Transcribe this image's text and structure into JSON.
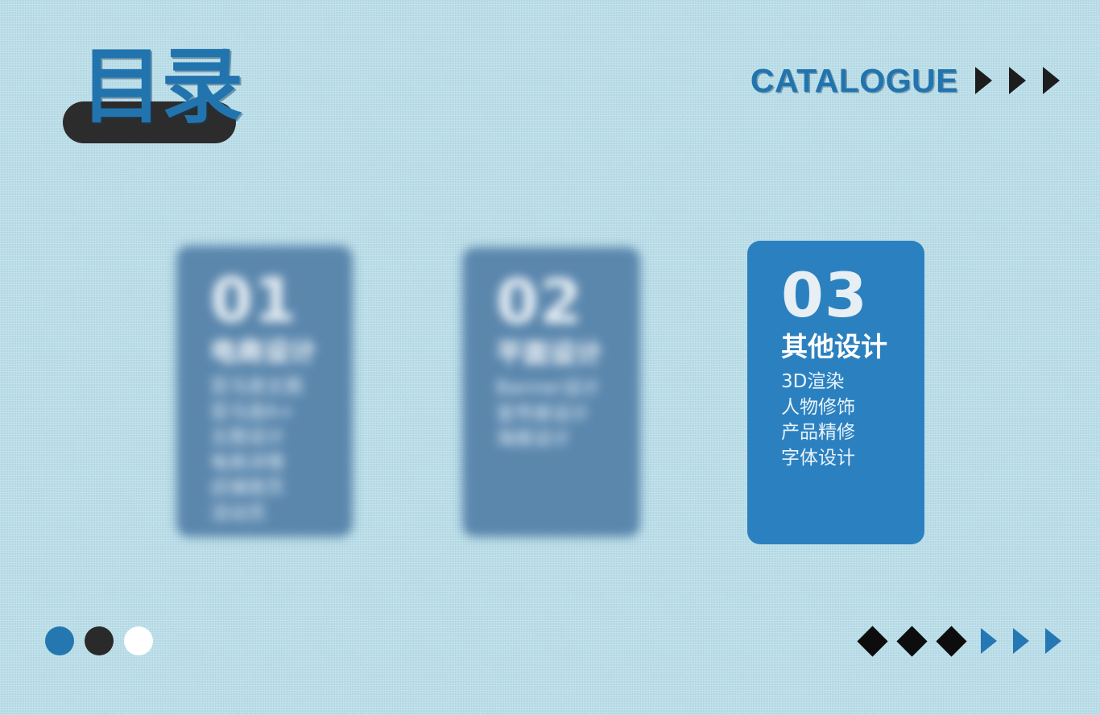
{
  "slide": {
    "background_color": "#b5dde9",
    "accent_blue": "#2274ae",
    "card_focus_color": "#2b81c0",
    "card_blur_color": "#5b87ad",
    "dark_color": "#2c2c2c"
  },
  "header": {
    "title_cn": "目录",
    "title_en": "CATALOGUE",
    "arrow_icons": [
      "triangle-right-icon",
      "triangle-right-icon",
      "triangle-right-icon"
    ]
  },
  "cards": [
    {
      "number": "01",
      "heading": "电商设计",
      "items": [
        "亚马逊主图",
        "亚马逊A+",
        "主图设计",
        "电商详情",
        "店铺首页",
        "活动页"
      ]
    },
    {
      "number": "02",
      "heading": "平面设计",
      "items": [
        "Banner设计",
        "宣传册设计",
        "海报设计"
      ]
    },
    {
      "number": "03",
      "heading": "其他设计",
      "items": [
        "3D渲染",
        "人物修饰",
        "产品精修",
        "字体设计"
      ]
    }
  ],
  "footer": {
    "dots": [
      {
        "name": "dot-blue",
        "color": "#2577b0"
      },
      {
        "name": "dot-dark",
        "color": "#2a2a2a"
      },
      {
        "name": "dot-white",
        "color": "#ffffff"
      }
    ],
    "diamonds": [
      "diamond-icon",
      "diamond-icon",
      "diamond-icon"
    ],
    "triangles": [
      "triangle-right-icon",
      "triangle-right-icon",
      "triangle-right-icon"
    ]
  }
}
